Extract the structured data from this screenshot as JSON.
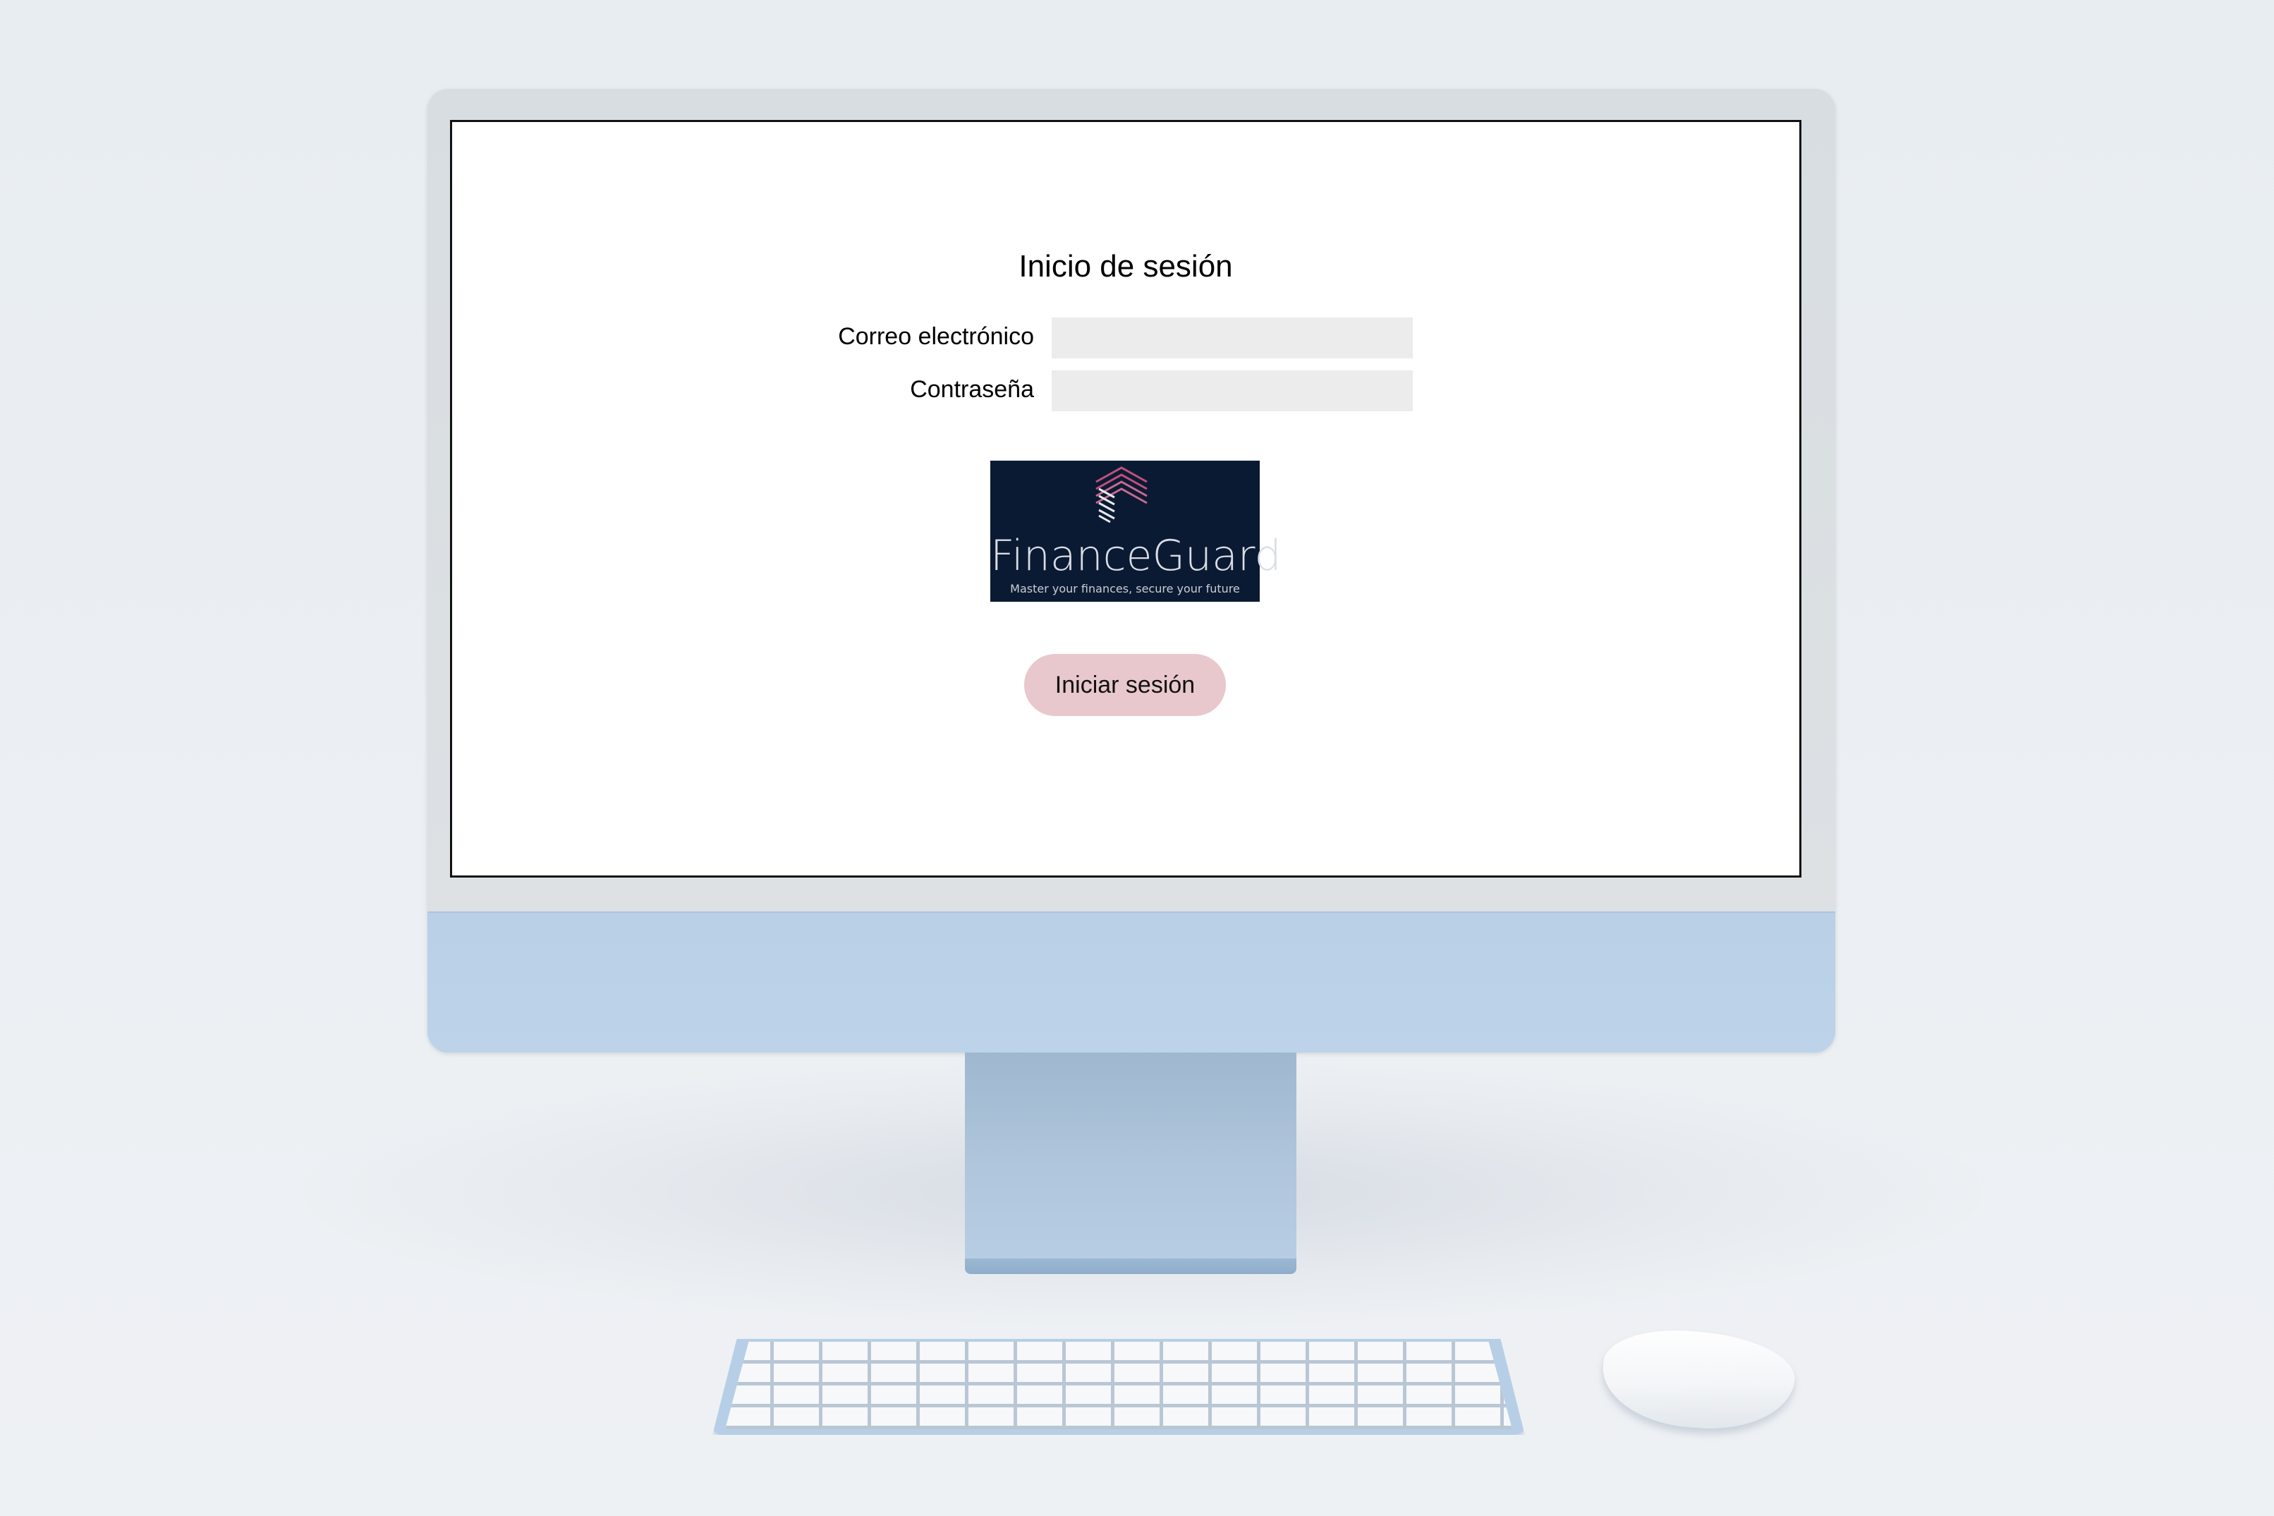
{
  "login": {
    "title": "Inicio de sesión",
    "email_label": "Correo electrónico",
    "email_value": "",
    "password_label": "Contraseña",
    "password_value": "",
    "submit_label": "Iniciar sesión"
  },
  "logo": {
    "name": "FinanceGuard",
    "tagline": "Master your finances, secure your future",
    "icon": "stacked-chevrons-icon"
  },
  "colors": {
    "button_bg": "#e8c8cc",
    "logo_bg": "#0b1a33",
    "monitor_chin": "#bcd3e9",
    "input_bg": "#ececec"
  }
}
